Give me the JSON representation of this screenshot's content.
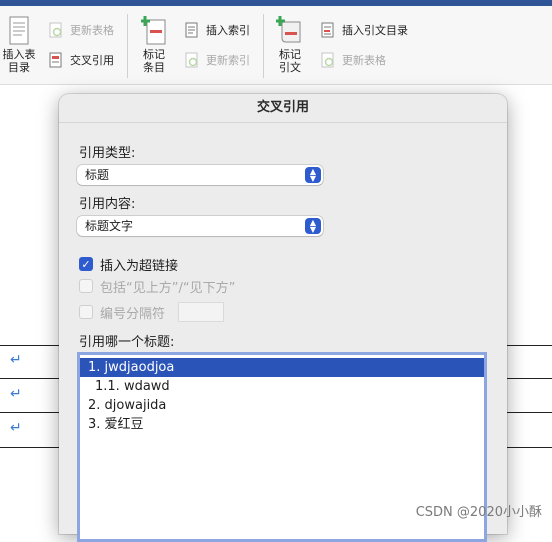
{
  "ribbon": {
    "insert_toc_label": "插入表\n目录",
    "update_table_1": "更新表格",
    "cross_reference": "交叉引用",
    "mark_entry_label": "标记\n条目",
    "insert_index": "插入索引",
    "update_index": "更新索引",
    "mark_citation_label": "标记\n引文",
    "insert_toa": "插入引文目录",
    "update_table_2": "更新表格"
  },
  "document": {
    "paragraph_mark": "↵"
  },
  "dialog": {
    "title": "交叉引用",
    "ref_type_label": "引用类型:",
    "ref_type_value": "标题",
    "ref_content_label": "引用内容:",
    "ref_content_value": "标题文字",
    "insert_hyperlink_label": "插入为超链接",
    "insert_hyperlink_checked": true,
    "include_above_below_label": "包括“见上方”/“见下方”",
    "separate_numbers_label": "编号分隔符",
    "which_heading_label": "引用哪一个标题:",
    "headings": [
      {
        "text": "1. jwdjaodjoa",
        "selected": true
      },
      {
        "text": "1.1. wdawd",
        "selected": false
      },
      {
        "text": "2. djowajida",
        "selected": false
      },
      {
        "text": "3. 爱红豆",
        "selected": false
      }
    ]
  },
  "watermark": "CSDN @2020小小酥",
  "colors": {
    "accent": "#2e5ccf",
    "selection": "#2b54b8",
    "paragraph_mark": "#3a7bd5"
  }
}
